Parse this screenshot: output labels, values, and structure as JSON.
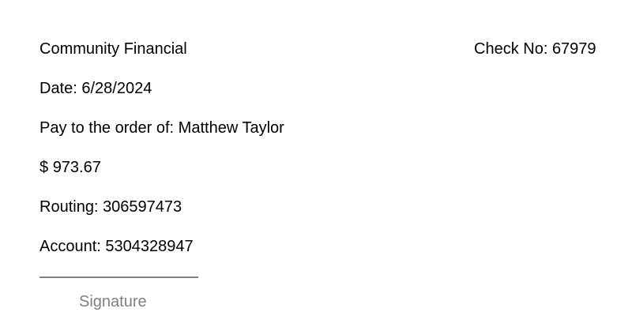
{
  "check": {
    "bank_name": "Community Financial",
    "check_number_label": "Check No:",
    "check_number": "67979",
    "date_label": "Date:",
    "date": "6/28/2024",
    "payee_label": "Pay to the order of:",
    "payee": "Matthew Taylor",
    "currency_symbol": "$",
    "amount": "973.67",
    "routing_label": "Routing:",
    "routing_number": "306597473",
    "account_label": "Account:",
    "account_number": "5304328947",
    "signature_label": "Signature"
  },
  "colors": {
    "text": "#000000",
    "signature_gray": "#808080",
    "background": "#ffffff"
  }
}
